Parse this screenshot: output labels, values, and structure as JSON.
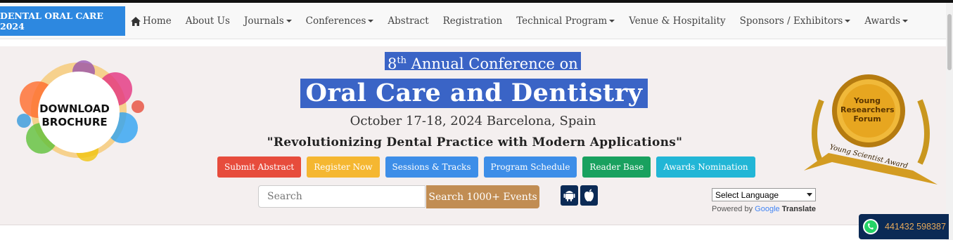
{
  "nav": {
    "brand": "DENTAL ORAL CARE 2024",
    "items": [
      {
        "label": "Home",
        "icon": "home-icon",
        "dropdown": false
      },
      {
        "label": "About Us",
        "dropdown": false
      },
      {
        "label": "Journals",
        "dropdown": true
      },
      {
        "label": "Conferences",
        "dropdown": true
      },
      {
        "label": "Abstract",
        "dropdown": false
      },
      {
        "label": "Registration",
        "dropdown": false
      },
      {
        "label": "Technical Program",
        "dropdown": true
      },
      {
        "label": "Venue & Hospitality",
        "dropdown": false
      },
      {
        "label": "Sponsors / Exhibitors",
        "dropdown": true
      },
      {
        "label": "Awards",
        "dropdown": true
      }
    ]
  },
  "hero": {
    "ordinal_num": "8",
    "ordinal_suffix": "th",
    "subtitle": " Annual Conference on",
    "title": "Oral Care and Dentistry",
    "dates": "October 17-18, 2024 Barcelona, Spain",
    "theme": "\"Revolutionizing Dental Practice with Modern Applications\"",
    "brochure_label_line1": "DOWNLOAD",
    "brochure_label_line2": "BROCHURE",
    "award_line1": "Young",
    "award_line2": "Researchers",
    "award_line3": "Forum",
    "award_ribbon": "Young Scientist Award"
  },
  "actions": [
    {
      "label": "Submit Abstract",
      "color": "#e74c3c"
    },
    {
      "label": "Register Now",
      "color": "#f5b731"
    },
    {
      "label": "Sessions & Tracks",
      "color": "#3d8ee8"
    },
    {
      "label": "Program Schedule",
      "color": "#3d8ee8"
    },
    {
      "label": "Reader Base",
      "color": "#19a15f"
    },
    {
      "label": "Awards Nomination",
      "color": "#22b6d6"
    }
  ],
  "search": {
    "placeholder": "Search",
    "button": "Search 1000+ Events"
  },
  "apps": [
    "android-icon",
    "apple-icon"
  ],
  "translate": {
    "select_value": "Select Language",
    "powered_by": "Powered by ",
    "google": "Google",
    "translate": "Translate"
  },
  "contact": {
    "phone": "441432 598387"
  },
  "colors": {
    "brand": "#2d88e0",
    "title_bg": "#3a64c6",
    "search_button": "#c18d53",
    "contact_bg": "#0b2a55"
  }
}
